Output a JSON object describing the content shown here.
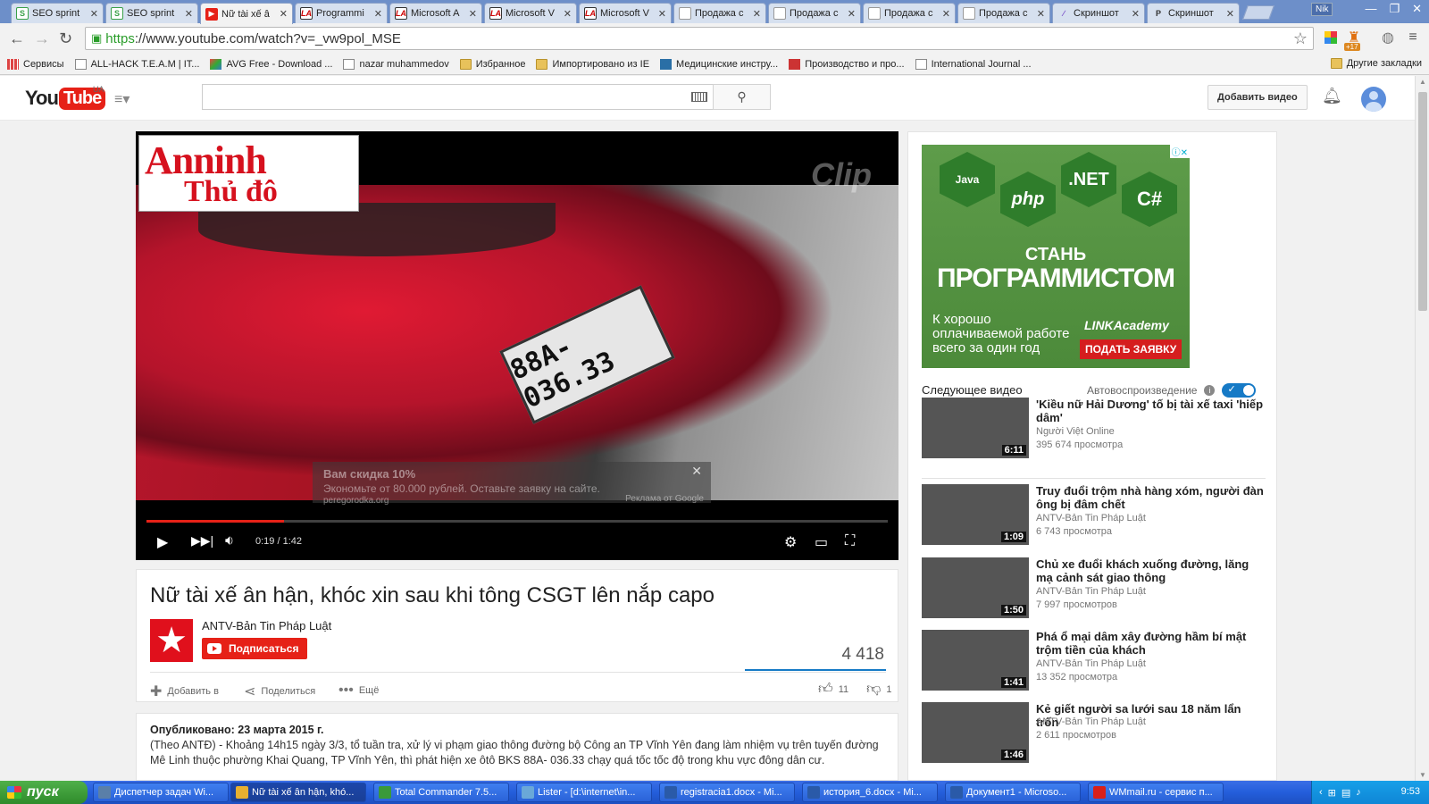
{
  "browser": {
    "tabs": [
      {
        "label": "SEO sprint",
        "icon": "seosprint-favicon"
      },
      {
        "label": "SEO sprint",
        "icon": "seosprint-favicon"
      },
      {
        "label": "Nữ tài xế â",
        "icon": "youtube-favicon",
        "active": true
      },
      {
        "label": "Programmi",
        "icon": "la-favicon"
      },
      {
        "label": "Microsoft A",
        "icon": "la-favicon"
      },
      {
        "label": "Microsoft V",
        "icon": "la-favicon"
      },
      {
        "label": "Microsoft V",
        "icon": "la-favicon"
      },
      {
        "label": "Продажа с",
        "icon": "document-favicon"
      },
      {
        "label": "Продажа с",
        "icon": "document-favicon"
      },
      {
        "label": "Продажа с",
        "icon": "document-favicon"
      },
      {
        "label": "Продажа с",
        "icon": "document-favicon"
      },
      {
        "label": "Скриншот",
        "icon": "screenshot-favicon"
      },
      {
        "label": "Скриншот",
        "icon": "p-favicon"
      }
    ],
    "user_badge": "Nik",
    "url_scheme": "https",
    "url_rest": "://www.youtube.com/watch?v=_vw9pol_MSE",
    "ext_badge": "+17",
    "bookmarks": [
      {
        "label": "Сервисы",
        "icon": "apps-grid-icon"
      },
      {
        "label": "ALL-HACK T.E.A.M | IT...",
        "icon": "page-icon"
      },
      {
        "label": "AVG Free - Download ...",
        "icon": "avg-icon"
      },
      {
        "label": "nazar muhammedov",
        "icon": "page-icon"
      },
      {
        "label": "Избранное",
        "icon": "folder-icon"
      },
      {
        "label": "Импортировано из IE",
        "icon": "folder-icon"
      },
      {
        "label": "Медицинские инстру...",
        "icon": "med-icon"
      },
      {
        "label": "Производство и про...",
        "icon": "prod-icon"
      },
      {
        "label": "International Journal ...",
        "icon": "page-icon"
      }
    ],
    "other_bookmarks": "Другие закладки"
  },
  "youtube": {
    "logo_you": "You",
    "logo_tube": "Tube",
    "country": "UA",
    "search_placeholder": "",
    "upload_label": "Добавить видео"
  },
  "player": {
    "logo_line1": "Anninh",
    "logo_line2": "Thủ đô",
    "watermark": "Clip",
    "plate": "88A-036.33",
    "ad": {
      "title": "Вам скидка 10%",
      "text": "Экономьте от 80.000 рублей. Оставьте заявку на сайте.",
      "domain": "peregorodka.org",
      "by": "Реклама от Google"
    },
    "current_time": "0:19",
    "duration": "1:42",
    "time_display": "0:19 / 1:42",
    "progress_fraction": 0.186
  },
  "video": {
    "title": "Nữ tài xế ân hận, khóc xin sau khi tông CSGT lên nắp capo",
    "channel": "ANTV-Bản Tin Pháp Luật",
    "subscribe_label": "Подписаться",
    "views": "4 418",
    "actions": {
      "add": "Добавить в",
      "share": "Поделиться",
      "more": "Ещё"
    },
    "likes": "11",
    "dislikes": "1"
  },
  "description": {
    "published": "Опубликовано: 23 марта 2015 г.",
    "text": "(Theo ANTĐ) - Khoảng 14h15 ngày 3/3, tổ tuần tra, xử lý vi phạm giao thông đường bộ Công an TP Vĩnh Yên đang làm nhiệm vụ trên tuyến đường Mê Linh thuộc phường Khai Quang, TP Vĩnh Yên, thì phát hiện xe ôtô BKS 88A- 036.33 chạy quá tốc tốc độ trong khu vực đông dân cư."
  },
  "sidebar": {
    "ad": {
      "badges": [
        "Java",
        "php",
        ".NET",
        "C#"
      ],
      "line1": "СТАНЬ",
      "line2": "ПРОГРАММИСТОМ",
      "text": "К хорошо оплачиваемой работе всего за один год",
      "brand": "LINKAcademy",
      "button": "ПОДАТЬ ЗАЯВКУ"
    },
    "next_label": "Следующее видео",
    "autoplay_label": "Автовоспроизведение",
    "videos": [
      {
        "title": "'Kiều nữ Hải Dương' tố bị tài xế taxi 'hiếp dâm'",
        "channel": "Người Việt Online",
        "views": "395 674 просмотра",
        "duration": "6:11"
      },
      {
        "title": "Truy đuổi trộm nhà hàng xóm, người đàn ông bị đâm chết",
        "channel": "ANTV-Bản Tin Pháp Luật",
        "views": "6 743 просмотра",
        "duration": "1:09"
      },
      {
        "title": "Chủ xe đuổi khách xuống đường, lăng mạ cảnh sát giao thông",
        "channel": "ANTV-Bản Tin Pháp Luật",
        "views": "7 997 просмотров",
        "duration": "1:50"
      },
      {
        "title": "Phá ổ mại dâm xây đường hầm bí mật trộm tiền của khách",
        "channel": "ANTV-Bản Tin Pháp Luật",
        "views": "13 352 просмотра",
        "duration": "1:41"
      },
      {
        "title": "Kẻ giết người sa lưới sau 18 năm lẩn trốn",
        "channel": "ANTV-Bản Tin Pháp Luật",
        "views": "2 611 просмотров",
        "duration": "1:46"
      }
    ]
  },
  "taskbar": {
    "start_label": "пуск",
    "items": [
      {
        "label": "Диспетчер задач Wi...",
        "color": "#5a7fa8"
      },
      {
        "label": "Nữ tài xế ân hận, khó...",
        "color": "#e8b030",
        "active": true
      },
      {
        "label": "Total Commander 7.5...",
        "color": "#3a9a3a"
      },
      {
        "label": "Lister - [d:\\internet\\in...",
        "color": "#6aa8d8"
      },
      {
        "label": "registracia1.docx - Mi...",
        "color": "#2a5aa8"
      },
      {
        "label": "история_6.docx - Mi...",
        "color": "#2a5aa8"
      },
      {
        "label": "Документ1 - Microso...",
        "color": "#2a5aa8"
      },
      {
        "label": "WMmail.ru - сервис п...",
        "color": "#d8201a"
      }
    ],
    "clock": "9:53"
  }
}
